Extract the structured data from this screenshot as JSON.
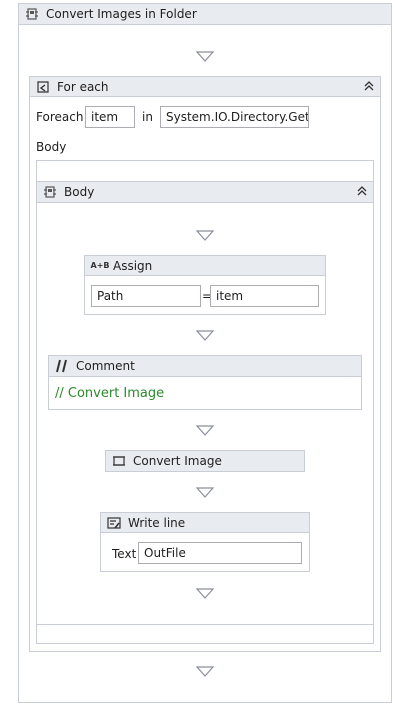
{
  "sequence": {
    "title": "Convert Images in Folder",
    "icon": "sequence-icon"
  },
  "foreach": {
    "title": "For each",
    "icon": "foreach-icon",
    "foreach_label": "Foreach",
    "item_value": "item",
    "in_label": "in",
    "collection_value": "System.IO.Directory.GetFil",
    "body_label": "Body"
  },
  "body": {
    "title": "Body",
    "icon": "sequence-icon"
  },
  "assign": {
    "title": "Assign",
    "icon": "assign-icon",
    "icon_text": "A+B",
    "to_value": "Path",
    "equals": "=",
    "value_value": "item"
  },
  "comment": {
    "title": "Comment",
    "icon": "comment-icon",
    "text": "// Convert Image",
    "text_color": "#2a8a2a"
  },
  "convert": {
    "title": "Convert Image",
    "icon": "invoke-icon"
  },
  "writeline": {
    "title": "Write line",
    "icon": "writeline-icon",
    "text_label": "Text",
    "text_value": "OutFile"
  },
  "colors": {
    "header_bg": "#e8ebef",
    "border": "#c9ced6",
    "arrow": "#8a8f98"
  }
}
